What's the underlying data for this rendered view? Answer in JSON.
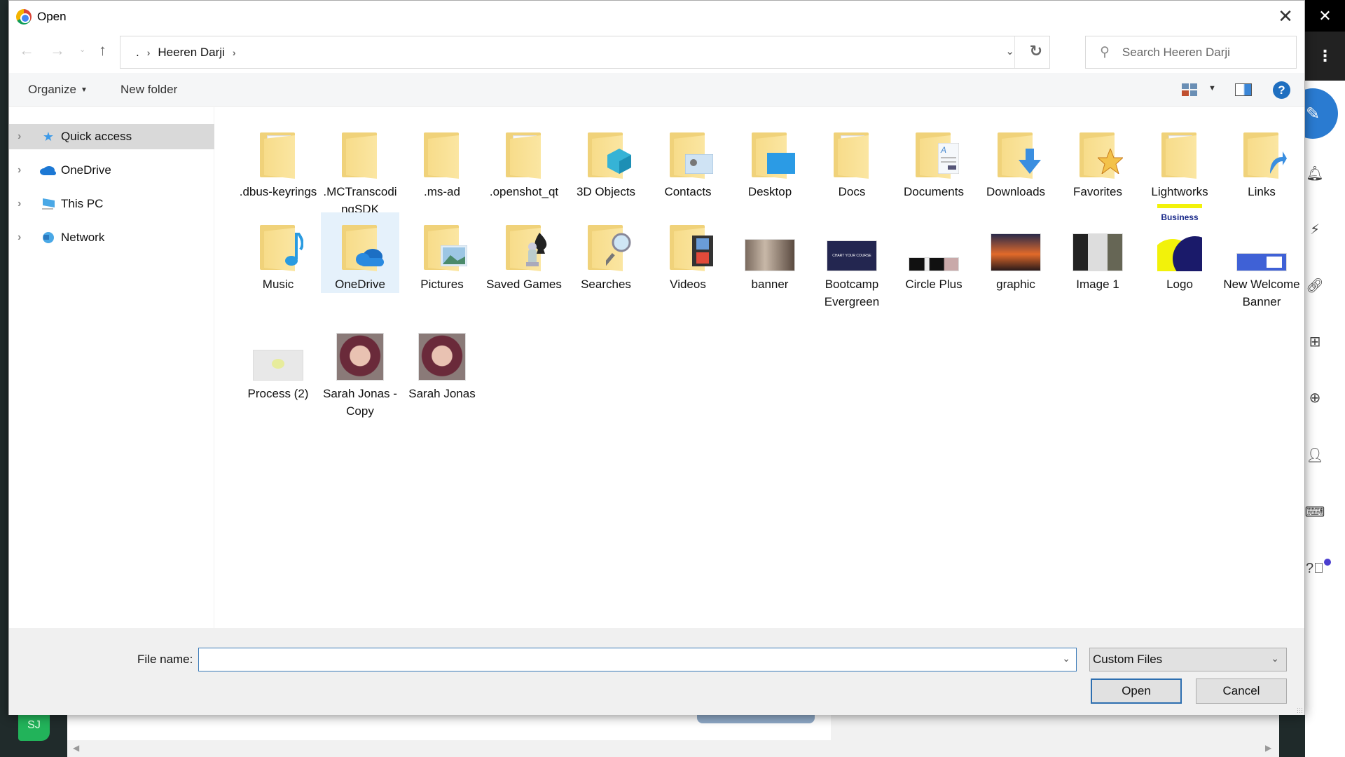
{
  "background_app": {
    "avatar_initials": "SJ",
    "top_close_icon": "close-icon",
    "menu_icon": "more-vertical-icon",
    "fab_icon": "edit-icon",
    "rail_icons": [
      "bell-icon",
      "flash-chat-icon",
      "link-icon",
      "apps-grid-icon",
      "add-box-icon",
      "add-person-icon",
      "keyboard-icon",
      "help-icon"
    ],
    "accent_color": "#2a7bd1"
  },
  "dialog": {
    "title": "Open",
    "close_symbol": "✕",
    "nav": {
      "back": "←",
      "forward": "→",
      "recent": "⌄",
      "up": "↑"
    },
    "breadcrumb": [
      ".",
      "Heeren Darji"
    ],
    "breadcrumb_sep": "›",
    "refresh": "↻",
    "search": {
      "placeholder": "Search Heeren Darji",
      "value": ""
    },
    "toolbar": {
      "organize": "Organize",
      "new_folder": "New folder",
      "help": "?"
    },
    "nav_pane": [
      {
        "label": "Quick access",
        "icon": "quick-access-star-icon",
        "selected": true
      },
      {
        "label": "OneDrive",
        "icon": "onedrive-cloud-icon",
        "selected": false
      },
      {
        "label": "This PC",
        "icon": "this-pc-icon",
        "selected": false
      },
      {
        "label": "Network",
        "icon": "network-icon",
        "selected": false
      }
    ],
    "items": [
      {
        "name": ".dbus-keyrings",
        "type": "folder-doc"
      },
      {
        "name": ".MCTranscodingSDK",
        "type": "folder"
      },
      {
        "name": ".ms-ad",
        "type": "folder"
      },
      {
        "name": ".openshot_qt",
        "type": "folder-doc"
      },
      {
        "name": "3D Objects",
        "type": "folder-3d"
      },
      {
        "name": "Contacts",
        "type": "folder-contacts"
      },
      {
        "name": "Desktop",
        "type": "folder-desktop"
      },
      {
        "name": "Docs",
        "type": "folder-doc"
      },
      {
        "name": "Documents",
        "type": "folder-documents"
      },
      {
        "name": "Downloads",
        "type": "folder-downloads"
      },
      {
        "name": "Favorites",
        "type": "folder-favorites"
      },
      {
        "name": "Lightworks",
        "type": "folder-doc"
      },
      {
        "name": "Links",
        "type": "folder-links"
      },
      {
        "name": "Music",
        "type": "folder-music"
      },
      {
        "name": "OneDrive",
        "type": "folder-onedrive",
        "selected": true
      },
      {
        "name": "Pictures",
        "type": "folder-pictures"
      },
      {
        "name": "Saved Games",
        "type": "folder-games"
      },
      {
        "name": "Searches",
        "type": "folder-searches"
      },
      {
        "name": "Videos",
        "type": "folder-videos"
      },
      {
        "name": "banner",
        "type": "image"
      },
      {
        "name": "Bootcamp Evergreen",
        "type": "image"
      },
      {
        "name": "Circle Plus",
        "type": "image"
      },
      {
        "name": "graphic",
        "type": "image"
      },
      {
        "name": "Image 1",
        "type": "image"
      },
      {
        "name": "Logo",
        "type": "image",
        "thumb_text": "Business"
      },
      {
        "name": "New Welcome Banner",
        "type": "image"
      },
      {
        "name": "Process (2)",
        "type": "image"
      },
      {
        "name": "Sarah Jonas - Copy",
        "type": "image"
      },
      {
        "name": "Sarah Jonas",
        "type": "image"
      }
    ],
    "footer": {
      "file_name_label": "File name:",
      "file_name_value": "",
      "file_type": "Custom Files",
      "open_label": "Open",
      "cancel_label": "Cancel"
    }
  }
}
